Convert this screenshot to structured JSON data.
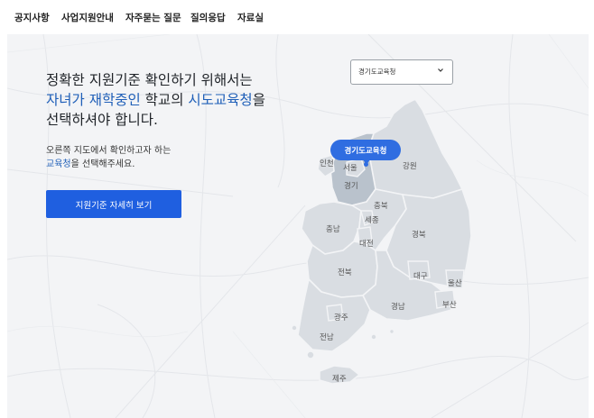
{
  "nav": {
    "items": [
      "공지사항",
      "사업지원안내",
      "자주묻는 질문",
      "질의응답",
      "자료실"
    ]
  },
  "hero": {
    "headline_line1": "정확한 지원기준 확인하기 위해서는",
    "headline_line2_a": "자녀가 재학중인",
    "headline_line2_b": " 학교의 ",
    "headline_line2_c": "시도교육청",
    "headline_line2_d": "을",
    "headline_line3": "선택하셔야 합니다.",
    "sub_line1": "오른쪽 지도에서 확인하고자 하는",
    "sub_line2_a": "교육청",
    "sub_line2_b": "을 선택해주세요.",
    "cta_label": "지원기준 자세히 보기"
  },
  "select": {
    "value": "경기도교육청",
    "icon": "chevron-down-icon"
  },
  "map": {
    "tooltip": "경기도교육청",
    "selected_region": "경기",
    "regions": {
      "incheon": "인천",
      "seoul": "서울",
      "gangwon": "강원",
      "gyeonggi": "경기",
      "chungbuk": "충북",
      "sejong": "세종",
      "chungnam": "충남",
      "daejeon": "대전",
      "gyeongbuk": "경북",
      "jeonbuk": "전북",
      "daegu": "대구",
      "ulsan": "울산",
      "busan": "부산",
      "gyeongnam": "경남",
      "gwangju": "광주",
      "jeonnam": "전남",
      "jeju": "제주"
    },
    "colors": {
      "land": "#d9dde2",
      "selected": "#b9c2cc",
      "border": "#f3f4f6",
      "accent": "#2f6de1"
    }
  }
}
